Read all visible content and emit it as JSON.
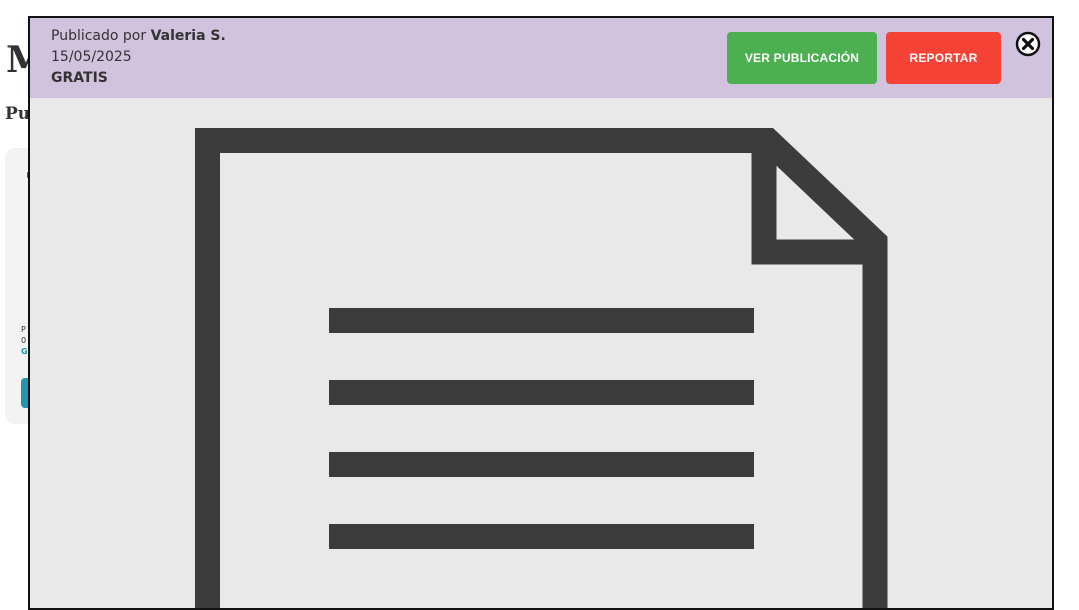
{
  "background": {
    "heading": "M",
    "subheading": "Pu",
    "card": {
      "line1": "P",
      "line2": "0",
      "line3": "G"
    }
  },
  "modal": {
    "published_by_prefix": "Publicado por ",
    "author": "Valeria S.",
    "date": "15/05/2025",
    "price": "GRATIS",
    "view_button": "VER PUBLICACIÓN",
    "report_button": "REPORTAR",
    "close_icon": "close-circle-icon",
    "preview_icon": "document-icon"
  },
  "colors": {
    "header_bg": "#d1c2dd",
    "view_button": "#4caf50",
    "report_button": "#f44336",
    "preview_bg": "#e9e9e9",
    "icon": "#3c3c3c",
    "card_button": "#2196b0"
  }
}
